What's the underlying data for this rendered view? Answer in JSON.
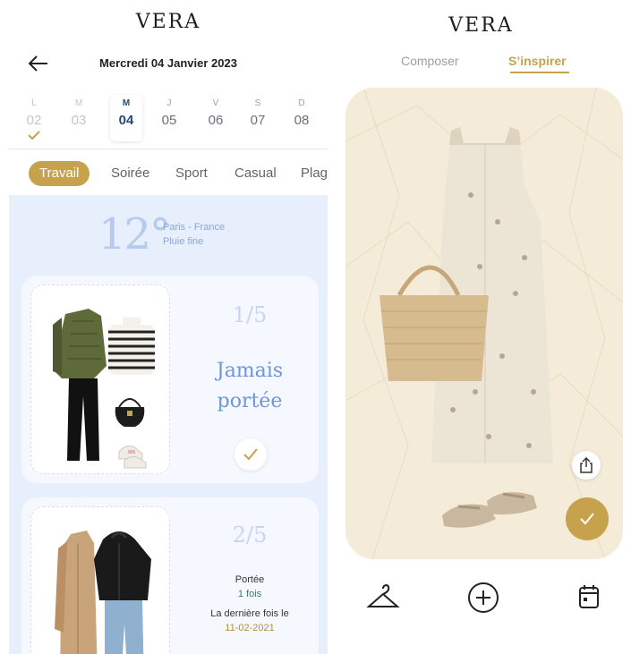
{
  "left": {
    "brand": "VERA",
    "date_title": "Mercredi 04 Janvier 2023",
    "week": [
      {
        "letter": "L",
        "num": "02",
        "state": "past",
        "done": true
      },
      {
        "letter": "M",
        "num": "03",
        "state": "past",
        "done": false
      },
      {
        "letter": "M",
        "num": "04",
        "state": "current",
        "done": false
      },
      {
        "letter": "J",
        "num": "05",
        "state": "future",
        "done": false
      },
      {
        "letter": "V",
        "num": "06",
        "state": "future",
        "done": false
      },
      {
        "letter": "S",
        "num": "07",
        "state": "future",
        "done": false
      },
      {
        "letter": "D",
        "num": "08",
        "state": "future",
        "done": false
      }
    ],
    "categories": [
      "Travail",
      "Soirée",
      "Sport",
      "Casual",
      "Plag"
    ],
    "active_category": "Travail",
    "weather": {
      "temp": "12°",
      "location": "Paris - France",
      "desc": "Pluie fine"
    },
    "cards": [
      {
        "count": "1/5",
        "status_line1": "Jamais",
        "status_line2": "portée",
        "worn": false
      },
      {
        "count": "2/5",
        "worn_label": "Portée",
        "worn_times": "1 fois",
        "last_label": "La dernière fois le",
        "last_date": "11-02-2021"
      }
    ]
  },
  "right": {
    "brand": "VERA",
    "tabs": [
      "Composer",
      "S’inspirer"
    ],
    "active_tab": "S’inspirer",
    "nav_icons": [
      "hanger-icon",
      "plus-circle-icon",
      "calendar-icon"
    ]
  },
  "colors": {
    "gold": "#c6a24d",
    "blue_bg": "#e7eefc",
    "navy": "#274a73",
    "status_blue": "#6d95da"
  }
}
